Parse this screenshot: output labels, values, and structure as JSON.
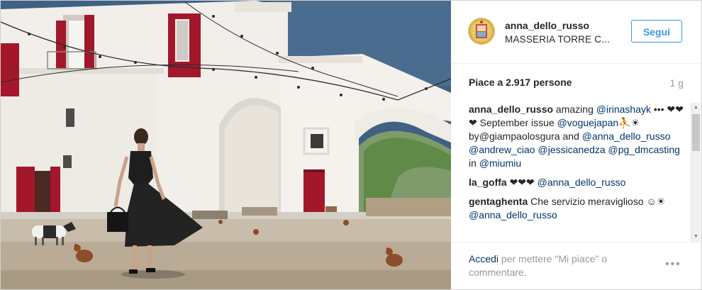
{
  "post": {
    "username": "anna_dello_russo",
    "location": "MASSERIA TORRE C...",
    "follow_label": "Segui",
    "likes": "Piace a 2.917 persone",
    "time": "1 g"
  },
  "comments": [
    {
      "user": "anna_dello_russo",
      "segments": [
        {
          "t": " amazing ",
          "m": false
        },
        {
          "t": "@irinashayk",
          "m": true
        },
        {
          "t": " ••• ❤❤❤ September issue ",
          "m": false
        },
        {
          "t": "@voguejapan",
          "m": true
        },
        {
          "t": "⛹☀ by@giampaolosgura and ",
          "m": false
        },
        {
          "t": "@anna_dello_russo",
          "m": true
        },
        {
          "t": " ",
          "m": false
        },
        {
          "t": "@andrew_ciao",
          "m": true
        },
        {
          "t": " ",
          "m": false
        },
        {
          "t": "@jessicanedza",
          "m": true
        },
        {
          "t": " ",
          "m": false
        },
        {
          "t": "@pg_dmcasting",
          "m": true
        },
        {
          "t": " in ",
          "m": false
        },
        {
          "t": "@miumiu",
          "m": true
        }
      ]
    },
    {
      "user": "la_goffa",
      "segments": [
        {
          "t": " ❤❤❤ ",
          "m": false
        },
        {
          "t": "@anna_dello_russo",
          "m": true
        }
      ]
    },
    {
      "user": "gentaghenta",
      "segments": [
        {
          "t": " Che servizio meraviglioso ☺☀ ",
          "m": false
        },
        {
          "t": "@anna_dello_russo",
          "m": true
        }
      ]
    }
  ],
  "footer": {
    "login_link": "Accedi",
    "login_text": " per mettere \"Mi piace\" o commentare.",
    "more_icon": "•••"
  },
  "colors": {
    "accent": "#3897f0",
    "mention": "#003569",
    "sky": "#3d5f7f",
    "wall": "#f2efea",
    "shutter": "#a3172a"
  }
}
